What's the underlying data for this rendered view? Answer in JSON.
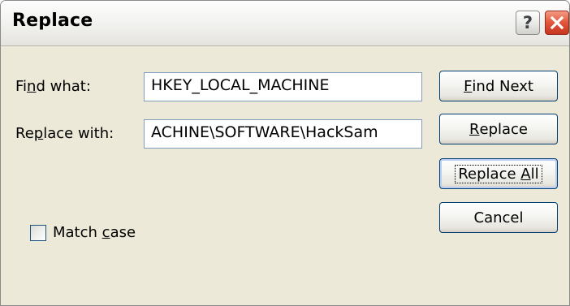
{
  "dialog": {
    "title": "Replace",
    "help_glyph": "?",
    "close_icon": "close-x-icon",
    "close_color": "#e2563a"
  },
  "find": {
    "label_pre": "Fi",
    "label_key": "n",
    "label_post": "d what:",
    "value": "HKEY_LOCAL_MACHINE"
  },
  "replace": {
    "label_pre": "Re",
    "label_key": "p",
    "label_post": "lace with:",
    "value": "ACHINE\\SOFTWARE\\HackSam"
  },
  "buttons": {
    "find_next": {
      "key": "F",
      "rest": "ind Next"
    },
    "replace": {
      "key": "R",
      "rest": "eplace"
    },
    "replace_all": {
      "pre": "Replace ",
      "key": "A",
      "rest": "ll"
    },
    "cancel": {
      "label": "Cancel"
    }
  },
  "match_case": {
    "label_pre": "Match ",
    "label_key": "c",
    "label_post": "ase",
    "checked": false
  },
  "colors": {
    "dialog_background": "#ece9d8",
    "button_border": "#003c74",
    "field_border": "#7f9db9"
  }
}
